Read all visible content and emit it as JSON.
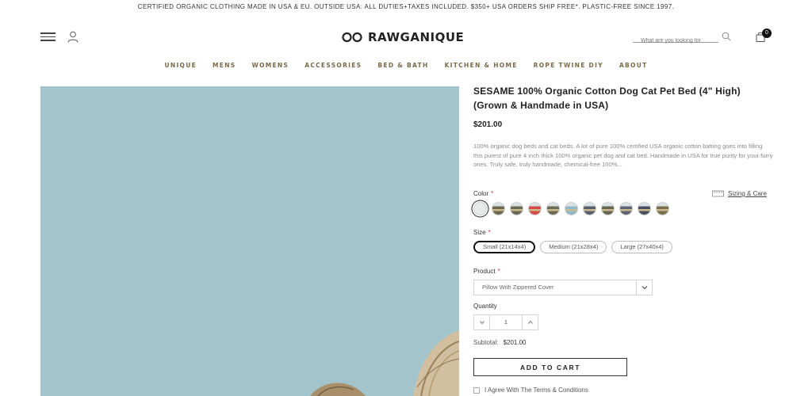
{
  "announcement": "CERTIFIED ORGANIC CLOTHING MADE IN USA & EU. OUTSIDE USA: ALL DUTIES+TAXES INCLUDED. $350+ USA ORDERS SHIP FREE*. PLASTIC-FREE SINCE 1997.",
  "header": {
    "logo_text": "RAWGANIQUE",
    "search_placeholder": "What are you looking for",
    "cart_count": "0"
  },
  "nav": {
    "items": [
      "UNIQUE",
      "MENS",
      "WOMENS",
      "ACCESSORIES",
      "BED & BATH",
      "KITCHEN & HOME",
      "ROPE TWINE DIY",
      "ABOUT"
    ]
  },
  "product": {
    "title": "SESAME 100% Organic Cotton Dog Cat Pet Bed (4\" High) (Grown & Handmade in USA)",
    "price": "$201.00",
    "description": "100% organic dog beds and cat beds. A lot of pure 100% certified USA organic cotton batting goes into filling this purest of pure 4 inch thick 100% organic pet dog and cat bed. Handmade in USA for true purity for your furry ones. Truly safe, truly handmade, chemical-free 100%...",
    "color_label": "Color",
    "required_mark": "*",
    "sizing_label": "Sizing & Care",
    "swatch_colors": [
      "#e7ebe9",
      "#6e6a52",
      "#6b6a54",
      "#d64a4a",
      "#6d6b55",
      "#8fb9c7",
      "#5a5f6e",
      "#66664e",
      "#5f6474",
      "#4a4d62",
      "#77704f"
    ],
    "size_label": "Size",
    "sizes": [
      "Small (21x14x4)",
      "Medium (21x28x4)",
      "Large (27x40x4)"
    ],
    "selected_size": "Small (21x14x4)",
    "product_label": "Product",
    "product_option": "Pillow With Zippered Cover",
    "quantity_label": "Quantity",
    "quantity": "1",
    "subtotal_label": "Subtotal:",
    "subtotal_value": "$201.00",
    "add_to_cart": "ADD TO CART",
    "agree_text": "I Agree With The Terms & Conditions"
  },
  "colors": {
    "nav_text": "#7a6a48",
    "photo_bg": "#a3c4cb",
    "required": "#c0392b"
  }
}
